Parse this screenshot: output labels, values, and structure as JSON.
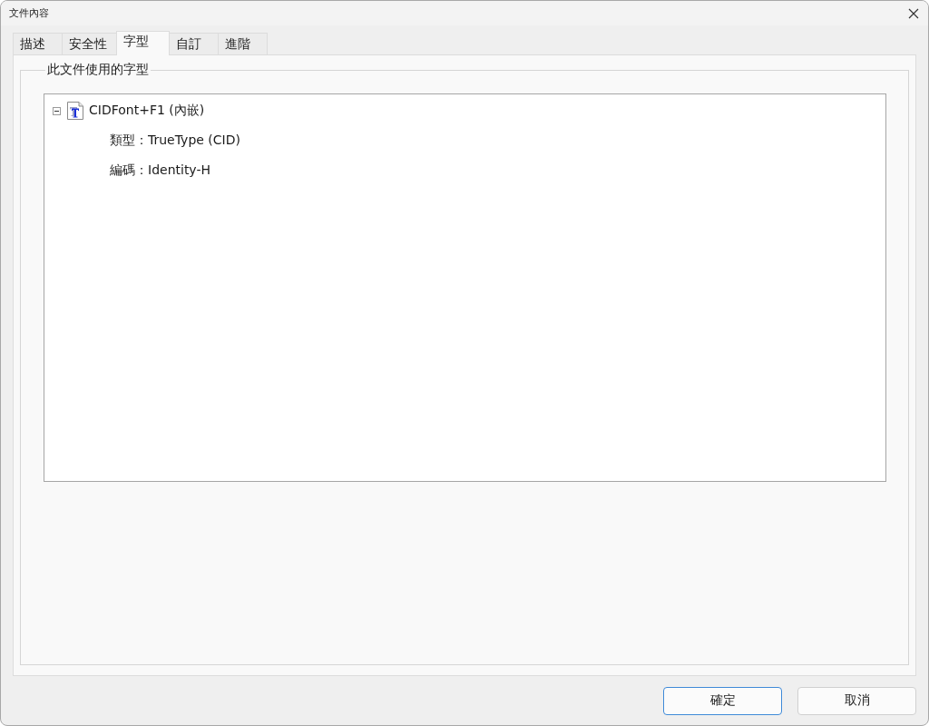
{
  "window": {
    "title": "文件內容"
  },
  "tabs": [
    {
      "label": "描述",
      "selected": false
    },
    {
      "label": "安全性",
      "selected": false
    },
    {
      "label": "字型",
      "selected": true
    },
    {
      "label": "自訂",
      "selected": false
    },
    {
      "label": "進階",
      "selected": false
    }
  ],
  "fonts_group": {
    "title": "此文件使用的字型",
    "tree": [
      {
        "label": "CIDFont+F1 (內嵌)",
        "expanded": true,
        "children": [
          {
            "label": "類型：TrueType (CID)"
          },
          {
            "label": "編碼：Identity-H"
          }
        ]
      }
    ]
  },
  "buttons": [
    {
      "label": "確定",
      "default": true
    },
    {
      "label": "取消",
      "default": false
    }
  ]
}
